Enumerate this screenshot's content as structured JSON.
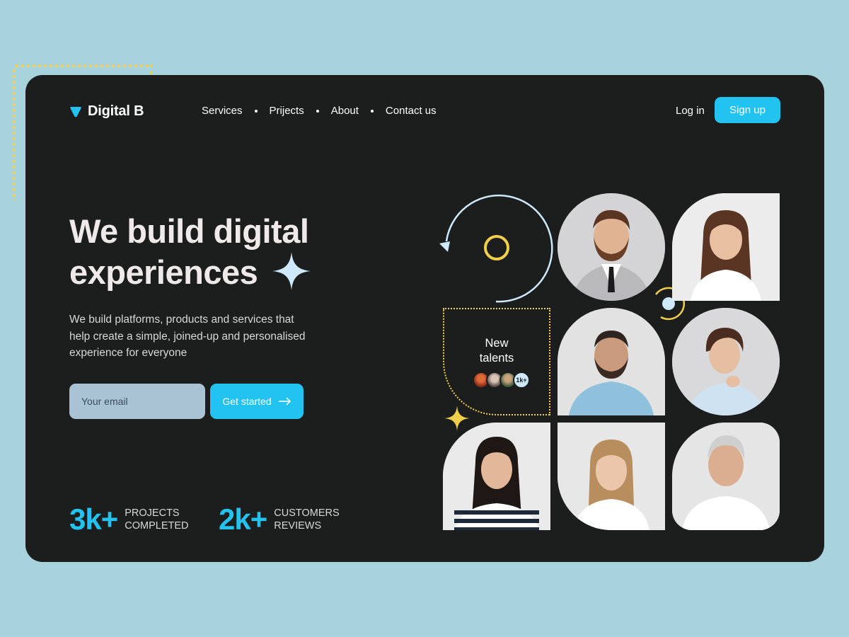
{
  "colors": {
    "page_background": "#a8d3dc",
    "card_background": "#1c1d1d",
    "accent_blue": "#22c3f0",
    "accent_yellow": "#f2cf4a",
    "light_blue": "#cde9fb",
    "input_background": "#a9c2d4"
  },
  "brand": {
    "name": "Digital B",
    "icon": "shield-icon"
  },
  "nav": {
    "items": [
      "Services",
      "Prijects",
      "About",
      "Contact us"
    ]
  },
  "auth": {
    "login": "Log in",
    "signup": "Sign up"
  },
  "hero": {
    "headline_line1": "We build digital",
    "headline_line2": "experiences",
    "subtext": "We build platforms, products and services that help create a simple, joined-up and personalised experience for everyone",
    "email_placeholder": "Your email",
    "cta_label": "Get started",
    "cta_icon": "arrow-right-icon"
  },
  "stats": [
    {
      "value": "3k+",
      "label_line1": "PROJECTS",
      "label_line2": "COMPLETED"
    },
    {
      "value": "2k+",
      "label_line1": "CUSTOMERS",
      "label_line2": "REVIEWS"
    }
  ],
  "talents": {
    "title_line1": "New",
    "title_line2": "talents",
    "count": "1k+"
  },
  "portraits": [
    "bearded-man-suit-photo",
    "smiling-woman-photo",
    "bearded-man-blue-shirt-photo",
    "short-hair-woman-photo",
    "woman-striped-top-photo",
    "blonde-woman-photo",
    "older-man-photo"
  ]
}
